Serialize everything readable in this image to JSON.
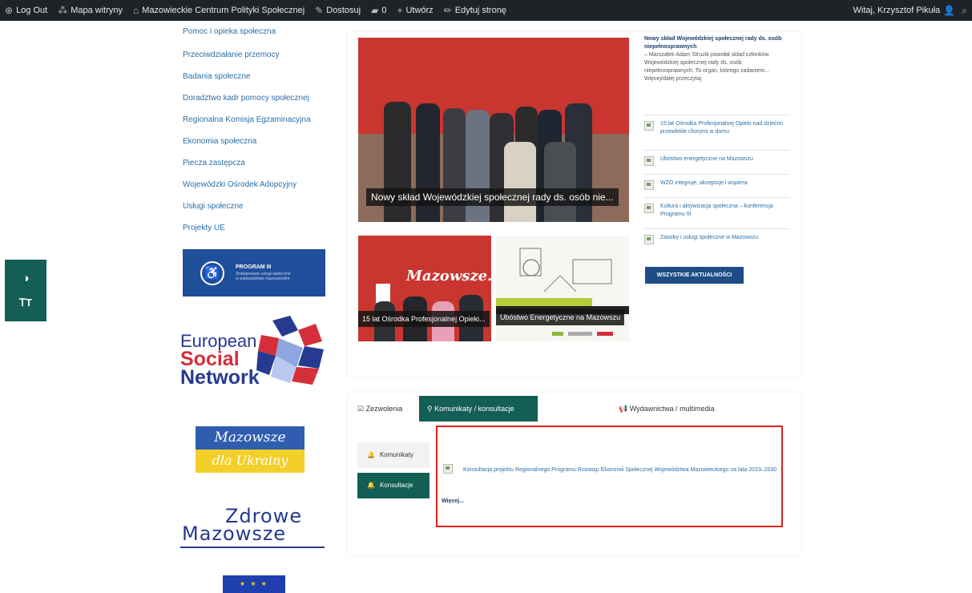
{
  "adminbar": {
    "logout": "Log Out",
    "sitemap": "Mapa witryny",
    "site_name": "Mazowieckie Centrum Polityki Społecznej",
    "customize": "Dostosuj",
    "comments_count": "0",
    "new": "Utwórz",
    "edit_page": "Edytuj stronę",
    "greeting": "Witaj, Krzysztof Pikuła"
  },
  "sidebar": {
    "items": [
      "Pomoc i opieka społeczna",
      "Przeciwdziałanie przemocy",
      "Badania społeczne",
      "Doradztwo kadr pomocy społecznej",
      "Regionalna Komisja Egzaminacyjna",
      "Ekonomia społeczna",
      "Piecza zastępcza",
      "Wojewódzki Ośrodek Adopcyjny",
      "Usługi społeczne",
      "Projekty UE"
    ]
  },
  "logos": {
    "program": "PROGRAM III",
    "program_sub": "Zintegrowane usługi społeczne\nw województwie mazowieckim",
    "esn": [
      "European",
      "Social",
      "Network"
    ],
    "mzu": [
      "Mazowsze",
      "dla Ukrainy"
    ],
    "zm_line1": "Zdrowe",
    "zm_line2": "Mazowsze",
    "eu": "★ ★ ★"
  },
  "featured": {
    "caption": "Nowy skład Wojewódzkiej społecznej rady ds. osób nie...",
    "thumb1_caption": "15 lat Ośrodka Profesjonalnej Opieki...",
    "thumb2_caption": "Ubóstwo Energetyczne na Mazowszu",
    "thumb1_brand": "Mazowsze."
  },
  "news": {
    "featured_title": "Nowy skład Wojewódzkiej społecznej rady ds. osób niepełnosprawnych",
    "featured_excerpt": "– Marszałek Adam Struzik powołał skład członków Wojewódzkiej społecznej rady ds. osób niepełnosprawnych. To organ, którego zadaniem... Więcej/dalej przeczytaj",
    "items": [
      "15 lat Ośrodka Profesjonalnej Opieki nad dziećmi przewlekle chorymi w domu",
      "Ubóstwo energetyczne na Mazowszu",
      "WZO integruje, akceptuje i wspiera",
      "Kultura i aktywizacja społeczna – konferencja Programu III",
      "Zasoby i usługi społeczne w Mazowszu"
    ],
    "all_button": "WSZYSTKIE AKTUALNOŚCI"
  },
  "tabs": {
    "items": [
      "Zezwolenia",
      "Komunikaty / konsultacje",
      "Wydawnictwa / multimedia"
    ],
    "active_index": 1,
    "subtabs": [
      "Komunikaty",
      "Konsultacje"
    ],
    "active_subtab": 1
  },
  "consultation": {
    "text": "Konsultacja projektu Regionalnego Programu Rozwoju Ekonomii Społecznej Województwa Mazowieckiego na lata 2023–2030",
    "more": "Więcej..."
  },
  "colors": {
    "admin_bar": "#1d2327",
    "accent_teal": "#135e55",
    "link_blue": "#2a6fa8",
    "highlight_red": "#e02020"
  }
}
